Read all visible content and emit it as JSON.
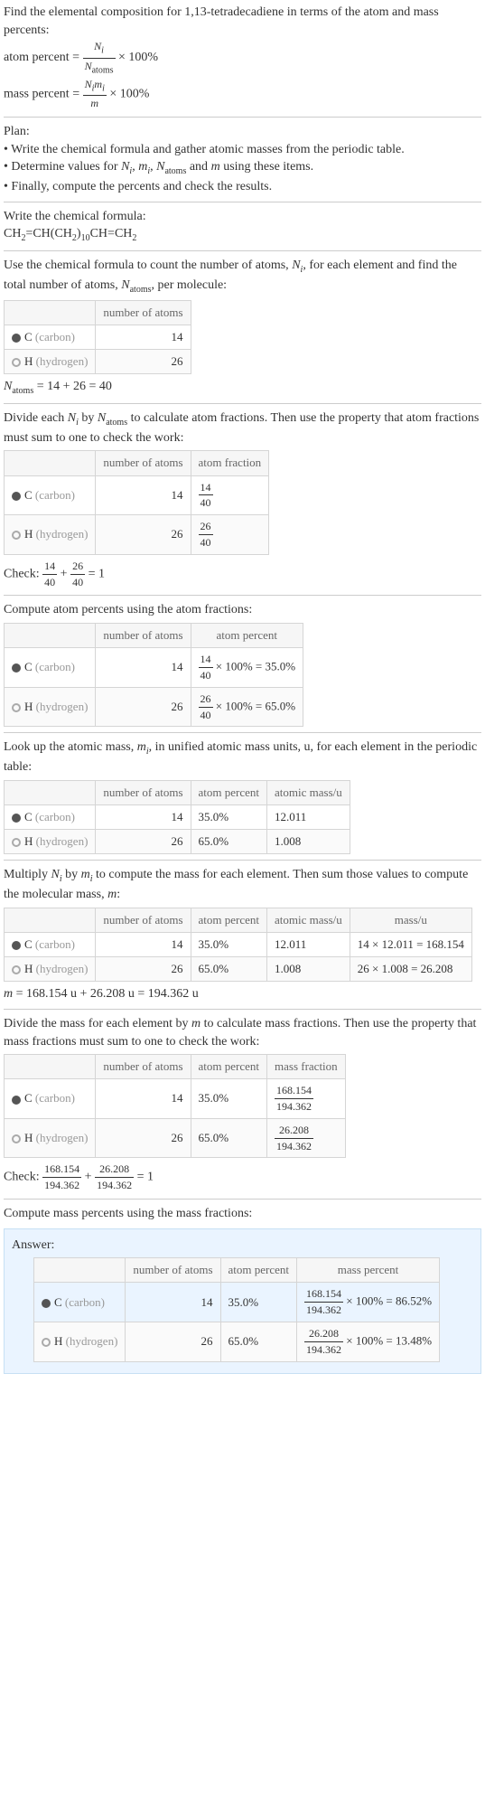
{
  "intro": {
    "prompt": "Find the elemental composition for 1,13-tetradecadiene in terms of the atom and mass percents:",
    "atom_eq_lhs": "atom percent = ",
    "atom_eq_num": "N",
    "atom_eq_num_sub": "i",
    "atom_eq_den": "N",
    "atom_eq_den_sub": "atoms",
    "atom_eq_rhs": " × 100%",
    "mass_eq_lhs": "mass percent = ",
    "mass_eq_num": "N",
    "mass_eq_num_sub1": "i",
    "mass_eq_num2": "m",
    "mass_eq_num_sub2": "i",
    "mass_eq_den": "m",
    "mass_eq_rhs": " × 100%"
  },
  "plan": {
    "h": "Plan:",
    "l1_a": "• Write the chemical formula and gather atomic masses from the periodic table.",
    "l2_a": "• Determine values for ",
    "l2_b": ", ",
    "l2_c": ", ",
    "l2_d": " and ",
    "l2_e": " using these items.",
    "Ni": "N",
    "Ni_s": "i",
    "mi": "m",
    "mi_s": "i",
    "Na": "N",
    "Na_s": "atoms",
    "m": "m",
    "l3": "• Finally, compute the percents and check the results."
  },
  "formula": {
    "h": "Write the chemical formula:",
    "f": "CH",
    "f2": "2",
    "f_eq": "=CH(CH",
    "f_sub2b": "2",
    "f_close": ")",
    "f_10": "10",
    "f_ch": "CH=CH",
    "f_2c": "2"
  },
  "count": {
    "p1": "Use the chemical formula to count the number of atoms, ",
    "Ni": "N",
    "Ni_s": "i",
    "p2": ", for each element and find the total number of atoms, ",
    "Na": "N",
    "Na_s": "atoms",
    "p3": ", per molecule:",
    "col1": "number of atoms",
    "c_label": "C ",
    "c_paren": "(carbon)",
    "c_n": "14",
    "h_label": "H ",
    "h_paren": "(hydrogen)",
    "h_n": "26",
    "sum": "N",
    "sum_s": "atoms",
    "sum_eq": " = 14 + 26 = 40"
  },
  "frac": {
    "p1": "Divide each ",
    "Ni": "N",
    "Ni_s": "i",
    "p2": " by ",
    "Na": "N",
    "Na_s": "atoms",
    "p3": " to calculate atom fractions. Then use the property that atom fractions must sum to one to check the work:",
    "col1": "number of atoms",
    "col2": "atom fraction",
    "c_n": "14",
    "c_num": "14",
    "c_den": "40",
    "h_n": "26",
    "h_num": "26",
    "h_den": "40",
    "check_l": "Check: ",
    "check_num1": "14",
    "check_den1": "40",
    "check_plus": " + ",
    "check_num2": "26",
    "check_den2": "40",
    "check_eq": " = 1"
  },
  "pct": {
    "p": "Compute atom percents using the atom fractions:",
    "col1": "number of atoms",
    "col2": "atom percent",
    "c_n": "14",
    "c_num": "14",
    "c_den": "40",
    "c_res": " × 100% = 35.0%",
    "h_n": "26",
    "h_num": "26",
    "h_den": "40",
    "h_res": " × 100% = 65.0%"
  },
  "amu": {
    "p1": "Look up the atomic mass, ",
    "mi": "m",
    "mi_s": "i",
    "p2": ", in unified atomic mass units, u, for each element in the periodic table:",
    "col1": "number of atoms",
    "col2": "atom percent",
    "col3": "atomic mass/u",
    "c_n": "14",
    "c_p": "35.0%",
    "c_m": "12.011",
    "h_n": "26",
    "h_p": "65.0%",
    "h_m": "1.008"
  },
  "massmul": {
    "p1": "Multiply ",
    "Ni": "N",
    "Ni_s": "i",
    "p2": " by ",
    "mi": "m",
    "mi_s": "i",
    "p3": " to compute the mass for each element. Then sum those values to compute the molecular mass, ",
    "m": "m",
    "p4": ":",
    "col1": "number of atoms",
    "col2": "atom percent",
    "col3": "atomic mass/u",
    "col4": "mass/u",
    "c_n": "14",
    "c_p": "35.0%",
    "c_m": "12.011",
    "c_mu": "14 × 12.011 = 168.154",
    "h_n": "26",
    "h_p": "65.0%",
    "h_m": "1.008",
    "h_mu": "26 × 1.008 = 26.208",
    "sum": "m",
    "sum_eq": " = 168.154 u + 26.208 u = 194.362 u"
  },
  "mfrac": {
    "p1": "Divide the mass for each element by ",
    "m": "m",
    "p2": " to calculate mass fractions. Then use the property that mass fractions must sum to one to check the work:",
    "col1": "number of atoms",
    "col2": "atom percent",
    "col3": "mass fraction",
    "c_n": "14",
    "c_p": "35.0%",
    "c_num": "168.154",
    "c_den": "194.362",
    "h_n": "26",
    "h_p": "65.0%",
    "h_num": "26.208",
    "h_den": "194.362",
    "check_l": "Check: ",
    "check_num1": "168.154",
    "check_den1": "194.362",
    "check_plus": " + ",
    "check_num2": "26.208",
    "check_den2": "194.362",
    "check_eq": " = 1"
  },
  "final": {
    "p": "Compute mass percents using the mass fractions:",
    "ans": "Answer:",
    "col1": "number of atoms",
    "col2": "atom percent",
    "col3": "mass percent",
    "c_n": "14",
    "c_p": "35.0%",
    "c_num": "168.154",
    "c_den": "194.362",
    "c_res": " × 100% = 86.52%",
    "h_n": "26",
    "h_p": "65.0%",
    "h_num": "26.208",
    "h_den": "194.362",
    "h_res": " × 100% = 13.48%"
  },
  "el": {
    "c": "C ",
    "c_p": "(carbon)",
    "h": "H ",
    "h_p": "(hydrogen)"
  }
}
